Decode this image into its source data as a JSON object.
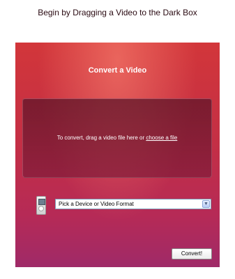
{
  "page": {
    "heading": "Begin by Dragging a Video to the Dark Box"
  },
  "panel": {
    "title": "Convert a Video",
    "drop_zone": {
      "prompt": "To convert, drag a video file here or",
      "link_label": "choose a file"
    },
    "device_icon": "ipod-icon",
    "format_select": {
      "value": "Pick a Device or Video Format",
      "arrow_icon": "chevron-down-icon"
    },
    "convert_button": "Convert!"
  },
  "colors": {
    "panel_top": "#d2363a",
    "panel_bottom": "#9f2a68",
    "drop_zone": "#5a1428"
  }
}
